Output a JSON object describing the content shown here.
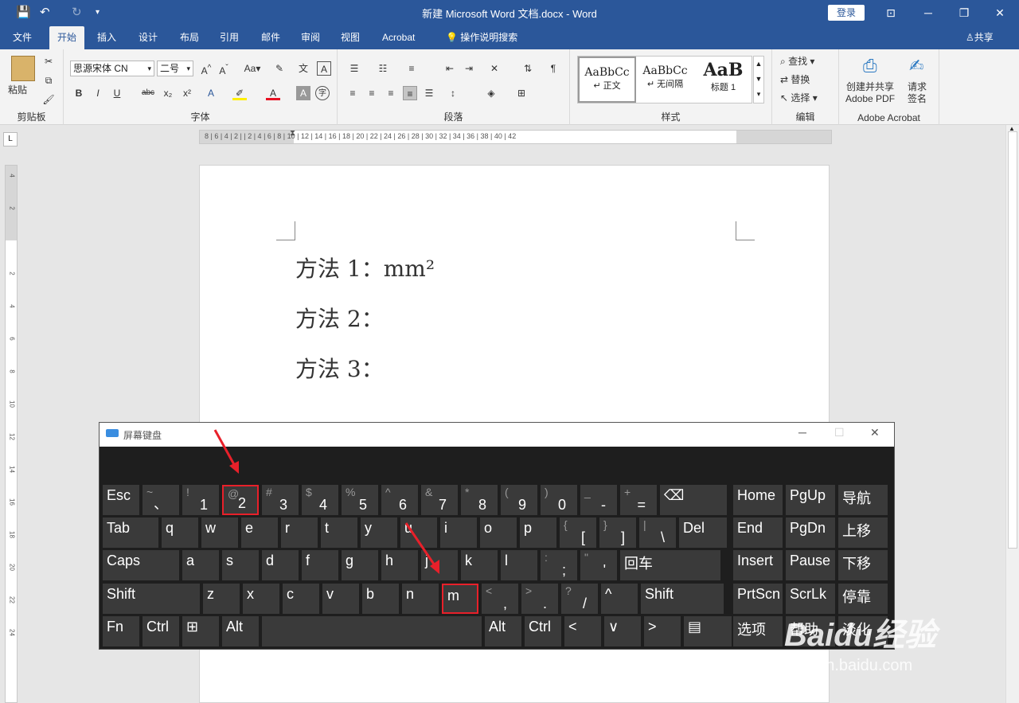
{
  "title": {
    "doc": "新建 Microsoft Word 文档.docx - Word",
    "login": "登录"
  },
  "qat": {
    "save": "💾",
    "undo": "↶",
    "redo": "↻",
    "more": "▾"
  },
  "window_controls": {
    "ribbon_opts": "⊡",
    "minimize": "─",
    "restore": "❐",
    "close": "✕"
  },
  "tabs": [
    "文件",
    "开始",
    "插入",
    "设计",
    "布局",
    "引用",
    "邮件",
    "审阅",
    "视图",
    "Acrobat"
  ],
  "tellme": "操作说明搜索",
  "share": "共享",
  "ribbon": {
    "clipboard": {
      "paste": "粘贴",
      "label": "剪贴板"
    },
    "font": {
      "name": "思源宋体 CN",
      "size": "二号",
      "label": "字体",
      "buttons": [
        "B",
        "I",
        "U",
        "abc",
        "x₂",
        "x²"
      ]
    },
    "paragraph": {
      "label": "段落"
    },
    "styles": {
      "label": "样式",
      "items": [
        {
          "preview": "AaBbCc",
          "name": "↵ 正文"
        },
        {
          "preview": "AaBbCc",
          "name": "↵ 无间隔"
        },
        {
          "preview": "AaB",
          "name": "标题 1"
        }
      ]
    },
    "editing": {
      "find": "查找",
      "replace": "替换",
      "select": "选择",
      "label": "编辑"
    },
    "acrobat": {
      "create1": "创建并共享",
      "create2": "Adobe PDF",
      "req1": "请求",
      "req2": "签名",
      "label": "Adobe Acrobat"
    }
  },
  "ruler": {
    "h": "8 | 6 | 4 | 2 |   | 2 | 4 | 6 | 8 | 10 | 12 | 14 | 16 | 18 | 20 | 22 | 24 | 26 | 28 | 30 | 32 | 34 | 36 | 38 | 40 | 42",
    "v": [
      "4",
      "2",
      "",
      "2",
      "4",
      "6",
      "8",
      "10",
      "12",
      "14",
      "16",
      "18",
      "20",
      "22",
      "24"
    ]
  },
  "document": {
    "lines": [
      "方法 1：mm²",
      "方法 2：",
      "方法 3："
    ]
  },
  "osk": {
    "title": "屏幕键盘",
    "rows": [
      [
        {
          "m": "Esc"
        },
        {
          "s": "~",
          "m": "、"
        },
        {
          "s": "!",
          "m": "1"
        },
        {
          "s": "@",
          "m": "2",
          "hl": true
        },
        {
          "s": "#",
          "m": "3"
        },
        {
          "s": "$",
          "m": "4"
        },
        {
          "s": "%",
          "m": "5"
        },
        {
          "s": "^",
          "m": "6"
        },
        {
          "s": "&",
          "m": "7"
        },
        {
          "s": "*",
          "m": "8"
        },
        {
          "s": "(",
          "m": "9"
        },
        {
          "s": ")",
          "m": "0"
        },
        {
          "s": "_",
          "m": "-"
        },
        {
          "s": "+",
          "m": "="
        },
        {
          "m": "⌫"
        }
      ],
      [
        {
          "m": "Tab"
        },
        {
          "m": "q"
        },
        {
          "m": "w"
        },
        {
          "m": "e"
        },
        {
          "m": "r"
        },
        {
          "m": "t"
        },
        {
          "m": "y"
        },
        {
          "m": "u"
        },
        {
          "m": "i"
        },
        {
          "m": "o"
        },
        {
          "m": "p"
        },
        {
          "s": "{",
          "m": "["
        },
        {
          "s": "}",
          "m": "]"
        },
        {
          "s": "|",
          "m": "\\"
        },
        {
          "m": "Del"
        }
      ],
      [
        {
          "m": "Caps"
        },
        {
          "m": "a"
        },
        {
          "m": "s"
        },
        {
          "m": "d"
        },
        {
          "m": "f"
        },
        {
          "m": "g"
        },
        {
          "m": "h"
        },
        {
          "m": "j"
        },
        {
          "m": "k"
        },
        {
          "m": "l"
        },
        {
          "s": ":",
          "m": ";"
        },
        {
          "s": "\"",
          "m": "'"
        },
        {
          "m": "回车"
        }
      ],
      [
        {
          "m": "Shift"
        },
        {
          "m": "z"
        },
        {
          "m": "x"
        },
        {
          "m": "c"
        },
        {
          "m": "v"
        },
        {
          "m": "b"
        },
        {
          "m": "n"
        },
        {
          "m": "m",
          "hl": true
        },
        {
          "s": "<",
          "m": ","
        },
        {
          "s": ">",
          "m": "."
        },
        {
          "s": "?",
          "m": "/"
        },
        {
          "m": "^"
        },
        {
          "m": "Shift"
        }
      ],
      [
        {
          "m": "Fn"
        },
        {
          "m": "Ctrl"
        },
        {
          "m": "⊞"
        },
        {
          "m": "Alt"
        },
        {
          "m": ""
        },
        {
          "m": "Alt"
        },
        {
          "m": "Ctrl"
        },
        {
          "m": "<"
        },
        {
          "m": "∨"
        },
        {
          "m": ">"
        },
        {
          "m": "▤"
        }
      ]
    ],
    "nav": [
      [
        "Home",
        "PgUp",
        "导航"
      ],
      [
        "End",
        "PgDn",
        "上移"
      ],
      [
        "Insert",
        "Pause",
        "下移"
      ],
      [
        "PrtScn",
        "ScrLk",
        "停靠"
      ],
      [
        "选项",
        "帮助",
        "淡化"
      ]
    ]
  },
  "watermark": {
    "brand": "Baidu经验",
    "url": "jingyan.baidu.com"
  }
}
